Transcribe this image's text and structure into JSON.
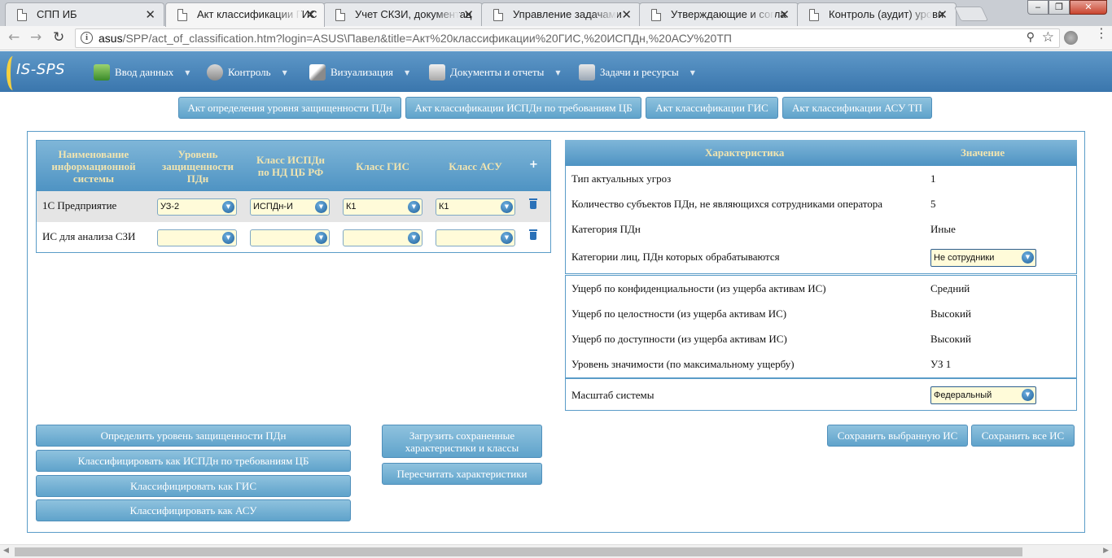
{
  "browser": {
    "tabs": [
      {
        "title": "СПП ИБ"
      },
      {
        "title": "Акт классификации ГИС"
      },
      {
        "title": "Учет СКЗИ, документац"
      },
      {
        "title": "Управление задачами"
      },
      {
        "title": "Утверждающие и согла"
      },
      {
        "title": "Контроль (аудит) уровн"
      }
    ],
    "url_host": "asus",
    "url_rest": "/SPP/act_of_classification.htm?login=ASUS\\Павел&title=Акт%20классификации%20ГИС,%20ИСПДн,%20АСУ%20ТП",
    "win_min": "‒",
    "win_max": "❐",
    "win_close": "✕"
  },
  "app": {
    "logo_text": "IS-SPS",
    "menu": [
      {
        "label": "Ввод данных",
        "icon": "data-entry-icon"
      },
      {
        "label": "Контроль",
        "icon": "control-icon"
      },
      {
        "label": "Визуализация",
        "icon": "visualization-icon"
      },
      {
        "label": "Документы и отчеты",
        "icon": "documents-icon"
      },
      {
        "label": "Задачи и ресурсы",
        "icon": "tasks-icon"
      }
    ],
    "top_buttons": [
      "Акт определения уровня защищенности ПДн",
      "Акт классификации ИСПДн по требованиям ЦБ",
      "Акт классификации ГИС",
      "Акт классификации АСУ ТП"
    ]
  },
  "systems_table": {
    "headers": {
      "name": "Наименование информационной системы",
      "level": "Уровень защищенности ПДн",
      "ispdn": "Класс ИСПДн по НД ЦБ РФ",
      "gis": "Класс ГИС",
      "asu": "Класс АСУ"
    },
    "add_label": "+",
    "rows": [
      {
        "name": "1С Предприятие",
        "level": "УЗ-2",
        "ispdn": "ИСПДн-И",
        "gis": "К1",
        "asu": "К1"
      },
      {
        "name": "ИС для анализа СЗИ",
        "level": "",
        "ispdn": "",
        "gis": "",
        "asu": ""
      }
    ]
  },
  "characteristics": {
    "header_name": "Характеристика",
    "header_value": "Значение",
    "group1": [
      {
        "label": "Тип актуальных угроз",
        "value": "1"
      },
      {
        "label": "Количество субъектов ПДн, не являющихся сотрудниками оператора",
        "value": "5"
      },
      {
        "label": "Категория ПДн",
        "value": "Иные"
      },
      {
        "label": "Категории лиц, ПДн которых обрабатываются",
        "value": "Не сотрудники"
      }
    ],
    "group2": [
      {
        "label": "Ущерб по конфиденциальности (из ущерба активам ИС)",
        "value": "Средний"
      },
      {
        "label": "Ущерб по целостности (из ущерба активам ИС)",
        "value": "Высокий"
      },
      {
        "label": "Ущерб по доступности (из ущерба активам ИС)",
        "value": "Высокий"
      },
      {
        "label": "Уровень значимости (по максимальному ущербу)",
        "value": "УЗ 1"
      }
    ],
    "group3": [
      {
        "label": "Масштаб системы",
        "value": "Федеральный"
      }
    ]
  },
  "actions": {
    "determine": "Определить уровень защищенности ПДн",
    "classify_ispdn": "Классифицировать как ИСПДн по требованиям ЦБ",
    "classify_gis": "Классифицировать как ГИС",
    "classify_asu": "Классифицировать как АСУ",
    "load_saved": "Загрузить сохраненные характеристики и классы",
    "recalc": "Пересчитать характеристики",
    "save_selected": "Сохранить выбранную ИС",
    "save_all": "Сохранить все ИС"
  }
}
